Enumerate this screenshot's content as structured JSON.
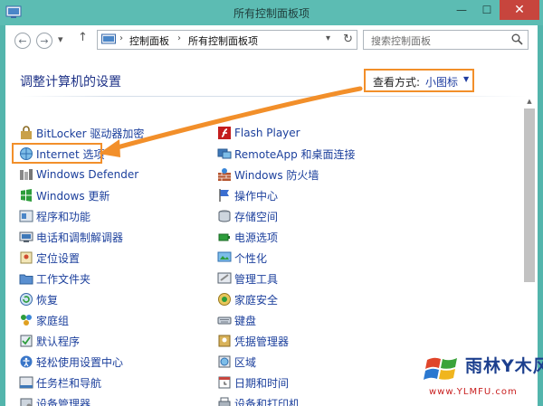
{
  "window": {
    "title": "所有控制面板项"
  },
  "titlebar": {
    "minimize_glyph": "—",
    "maximize_glyph": "☐",
    "close_glyph": "✕"
  },
  "nav": {
    "back_glyph": "←",
    "forward_glyph": "→",
    "dropdown_glyph": "▾",
    "up_glyph": "↑",
    "breadcrumb": [
      "控制面板",
      "所有控制面板项"
    ],
    "breadcrumb_sep": "›",
    "address_dropdown": "▾",
    "refresh_glyph": "↻",
    "search_placeholder": "搜索控制面板"
  },
  "header": {
    "title": "调整计算机的设置",
    "view_label": "查看方式:",
    "view_value": "小图标",
    "view_arrow": "▼"
  },
  "colors": {
    "accent": "#1b3f9c",
    "highlight": "#f28f2a",
    "titlebar": "#5cbcb3",
    "close": "#c7453d"
  },
  "items_left": [
    {
      "label": "BitLocker 驱动器加密",
      "icon": "bitlocker-icon"
    },
    {
      "label": "Internet 选项",
      "icon": "internet-options-icon"
    },
    {
      "label": "Windows Defender",
      "icon": "defender-icon"
    },
    {
      "label": "Windows 更新",
      "icon": "windows-update-icon"
    },
    {
      "label": "程序和功能",
      "icon": "programs-icon"
    },
    {
      "label": "电话和调制解调器",
      "icon": "phone-modem-icon"
    },
    {
      "label": "定位设置",
      "icon": "location-icon"
    },
    {
      "label": "工作文件夹",
      "icon": "work-folders-icon"
    },
    {
      "label": "恢复",
      "icon": "recovery-icon"
    },
    {
      "label": "家庭组",
      "icon": "homegroup-icon"
    },
    {
      "label": "默认程序",
      "icon": "default-programs-icon"
    },
    {
      "label": "轻松使用设置中心",
      "icon": "ease-of-access-icon"
    },
    {
      "label": "任务栏和导航",
      "icon": "taskbar-icon"
    },
    {
      "label": "设备管理器",
      "icon": "device-manager-icon"
    }
  ],
  "items_right": [
    {
      "label": "Flash Player",
      "icon": "flash-icon"
    },
    {
      "label": "RemoteApp 和桌面连接",
      "icon": "remoteapp-icon"
    },
    {
      "label": "Windows 防火墙",
      "icon": "firewall-icon"
    },
    {
      "label": "操作中心",
      "icon": "action-center-icon"
    },
    {
      "label": "存储空间",
      "icon": "storage-spaces-icon"
    },
    {
      "label": "电源选项",
      "icon": "power-icon"
    },
    {
      "label": "个性化",
      "icon": "personalization-icon"
    },
    {
      "label": "管理工具",
      "icon": "admin-tools-icon"
    },
    {
      "label": "家庭安全",
      "icon": "family-safety-icon"
    },
    {
      "label": "键盘",
      "icon": "keyboard-icon"
    },
    {
      "label": "凭据管理器",
      "icon": "credential-icon"
    },
    {
      "label": "区域",
      "icon": "region-icon"
    },
    {
      "label": "日期和时间",
      "icon": "date-time-icon"
    },
    {
      "label": "设备和打印机",
      "icon": "devices-printers-icon"
    }
  ],
  "watermark": {
    "title": "雨林Y木风",
    "url": "www.YLMFU.com"
  }
}
